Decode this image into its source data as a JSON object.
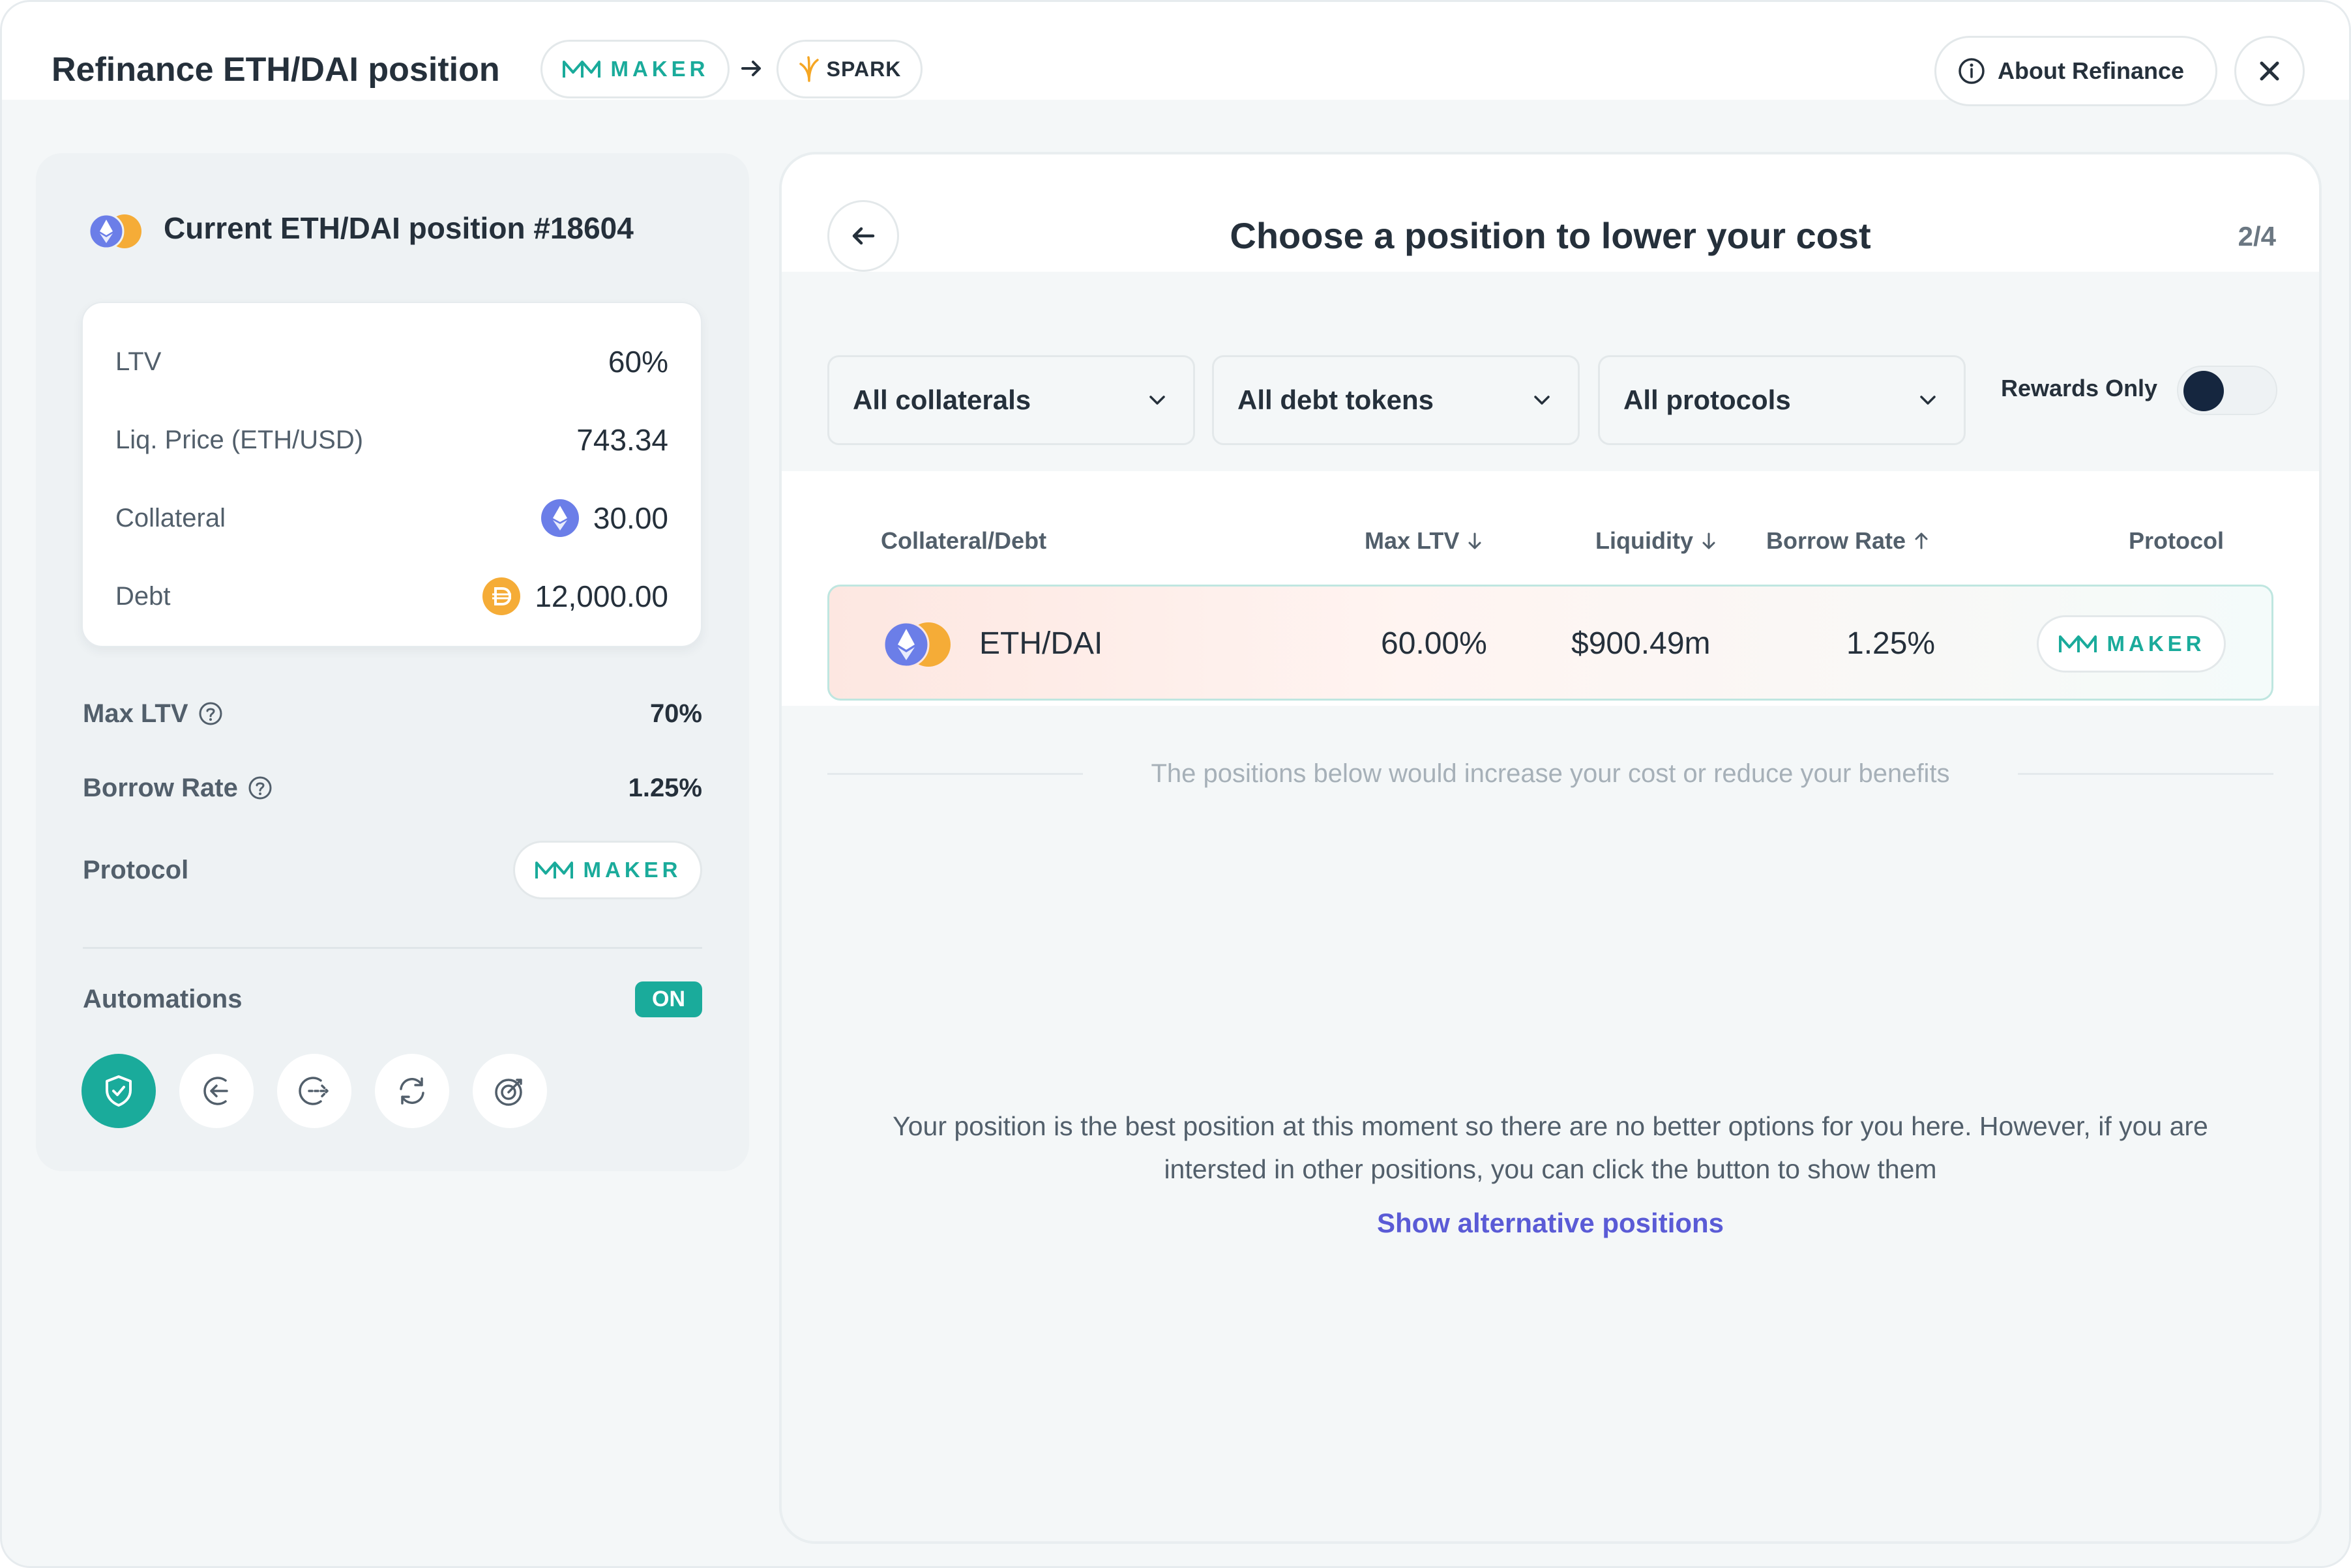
{
  "header": {
    "title": "Refinance ETH/DAI position",
    "from_protocol": "MAKER",
    "to_protocol": "SPARK",
    "about_label": "About Refinance"
  },
  "current": {
    "title": "Current ETH/DAI position #18604",
    "details": [
      {
        "label": "LTV",
        "value": "60%"
      },
      {
        "label": "Liq. Price (ETH/USD)",
        "value": "743.34"
      },
      {
        "label": "Collateral",
        "value": "30.00",
        "icon": "eth-icon"
      },
      {
        "label": "Debt",
        "value": "12,000.00",
        "icon": "dai-icon"
      }
    ],
    "max_ltv_label": "Max LTV",
    "max_ltv_value": "70%",
    "borrow_rate_label": "Borrow Rate",
    "borrow_rate_value": "1.25%",
    "protocol_label": "Protocol",
    "protocol_value": "MAKER",
    "automations_label": "Automations",
    "automations_status": "ON"
  },
  "step": {
    "title": "Choose a position to lower your cost",
    "counter": "2/4"
  },
  "filters": {
    "collaterals": "All collaterals",
    "debt_tokens": "All debt tokens",
    "protocols": "All protocols",
    "rewards_label": "Rewards Only"
  },
  "table": {
    "headers": {
      "pair": "Collateral/Debt",
      "max_ltv": "Max LTV",
      "liquidity": "Liquidity",
      "borrow_rate": "Borrow Rate",
      "protocol": "Protocol"
    },
    "row": {
      "pair": "ETH/DAI",
      "max_ltv": "60.00%",
      "liquidity": "$900.49m",
      "borrow_rate": "1.25%",
      "protocol": "MAKER"
    }
  },
  "separator_text": "The positions below would increase your cost or reduce your benefits",
  "message": "Your position is the best position at this moment so there are no better options for you here. However, if you are intersted in other positions, you can click the button to show them",
  "alt_link": "Show alternative positions",
  "colors": {
    "accent": "#1aab9b",
    "link": "#5a5bd6",
    "eth": "#6b7ee8",
    "dai": "#f5ac37"
  }
}
